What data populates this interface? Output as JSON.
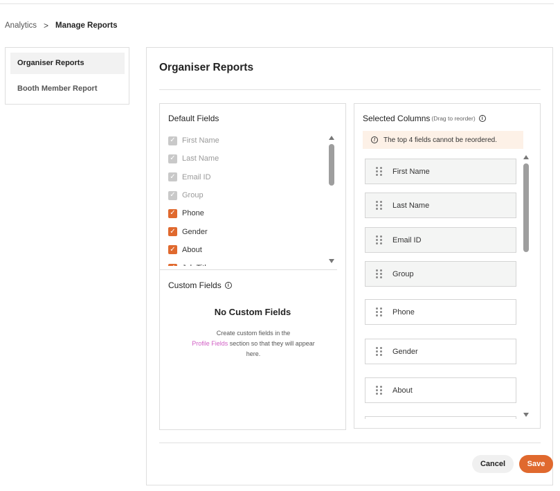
{
  "breadcrumb": {
    "items": [
      "Analytics",
      "Manage Reports"
    ],
    "separator": ">"
  },
  "sidebar": {
    "items": [
      {
        "label": "Organiser Reports",
        "active": true
      },
      {
        "label": "Booth Member Report",
        "active": false
      }
    ]
  },
  "main": {
    "title": "Organiser Reports",
    "default_fields": {
      "title": "Default Fields",
      "fields": [
        {
          "label": "First Name",
          "checked": true,
          "disabled": true
        },
        {
          "label": "Last Name",
          "checked": true,
          "disabled": true
        },
        {
          "label": "Email ID",
          "checked": true,
          "disabled": true
        },
        {
          "label": "Group",
          "checked": true,
          "disabled": true
        },
        {
          "label": "Phone",
          "checked": true,
          "disabled": false
        },
        {
          "label": "Gender",
          "checked": true,
          "disabled": false
        },
        {
          "label": "About",
          "checked": true,
          "disabled": false
        },
        {
          "label": "Job Title",
          "checked": true,
          "disabled": false
        }
      ]
    },
    "custom_fields": {
      "title": "Custom Fields",
      "empty_title": "No Custom Fields",
      "empty_desc_before": "Create custom fields in the",
      "empty_link": "Profile Fields",
      "empty_desc_after": "section so that they will appear here."
    },
    "selected_columns": {
      "title": "Selected Columns",
      "hint": "(Drag to reorder)",
      "notice": "The top 4 fields cannot be reordered.",
      "items": [
        {
          "label": "First Name",
          "locked": true
        },
        {
          "label": "Last Name",
          "locked": true
        },
        {
          "label": "Email ID",
          "locked": true
        },
        {
          "label": "Group",
          "locked": true
        },
        {
          "label": "Phone",
          "locked": false
        },
        {
          "label": "Gender",
          "locked": false
        },
        {
          "label": "About",
          "locked": false
        },
        {
          "label": "",
          "locked": false
        }
      ]
    }
  },
  "actions": {
    "cancel": "Cancel",
    "save": "Save"
  },
  "colors": {
    "accent": "#e0692e",
    "link": "#d15fc5",
    "notice_bg": "#fdf1e7"
  },
  "icons": {
    "check": "check-icon",
    "info": "info-icon",
    "drag": "drag-handle-icon"
  }
}
